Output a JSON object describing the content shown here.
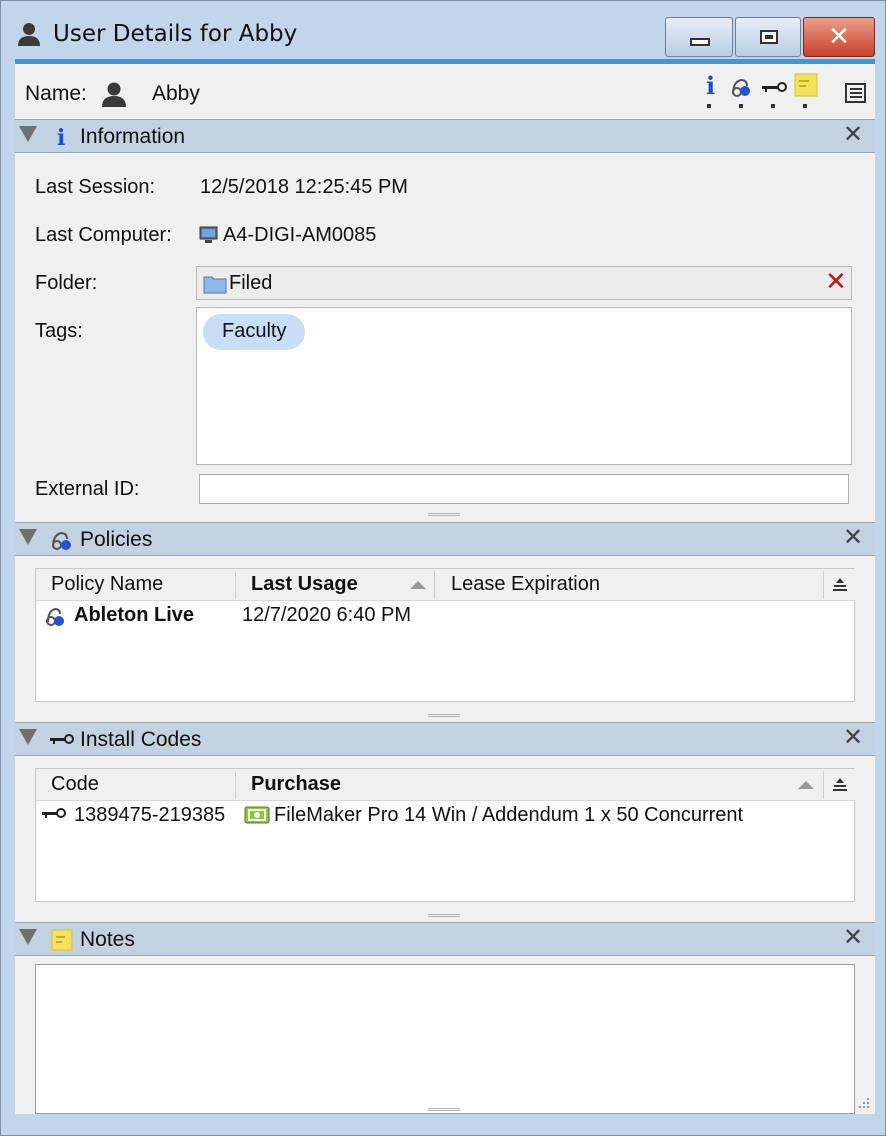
{
  "window": {
    "title": "User Details for Abby",
    "buttons": {
      "minimize": "minimize",
      "maximize": "maximize",
      "close": "close"
    }
  },
  "name_row": {
    "label": "Name:",
    "value": "Abby",
    "toolbar_icons": [
      "info-icon",
      "policy-icon",
      "key-icon",
      "note-icon"
    ],
    "list_icon": "list-view-icon"
  },
  "information": {
    "title": "Information",
    "fields": {
      "last_session_label": "Last Session:",
      "last_session_value": "12/5/2018 12:25:45 PM",
      "last_computer_label": "Last Computer:",
      "last_computer_value": "A4-DIGI-AM0085",
      "folder_label": "Folder:",
      "folder_value": "Filed",
      "tags_label": "Tags:",
      "tags": [
        "Faculty"
      ],
      "external_id_label": "External ID:",
      "external_id_value": ""
    }
  },
  "policies": {
    "title": "Policies",
    "columns": [
      "Policy Name",
      "Last Usage",
      "Lease Expiration"
    ],
    "rows": [
      {
        "name": "Ableton Live",
        "last_usage": "12/7/2020 6:40 PM",
        "lease_expiration": ""
      }
    ]
  },
  "install_codes": {
    "title": "Install Codes",
    "columns": [
      "Code",
      "Purchase"
    ],
    "rows": [
      {
        "code": "1389475-219385",
        "purchase": "FileMaker Pro 14 Win / Addendum 1 x 50 Concurrent"
      }
    ]
  },
  "notes": {
    "title": "Notes",
    "value": ""
  },
  "colors": {
    "title_bar": "#c3d5ea",
    "accent": "#3a9ad9",
    "section_header": "#c3d2e0",
    "tag_pill": "#c8def6",
    "close_button": "#c9402a",
    "info_icon": "#1f4fd1"
  }
}
